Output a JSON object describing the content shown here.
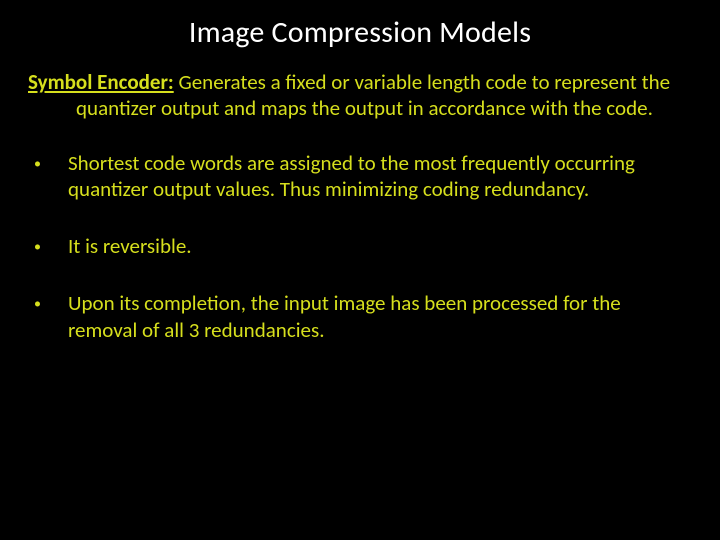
{
  "title": "Image Compression Models",
  "intro": {
    "label": "Symbol Encoder:",
    "text": " Generates a fixed or variable length code to represent the quantizer output and maps the output in accordance with the code."
  },
  "bullets": [
    "Shortest code words are assigned to the most frequently occurring quantizer output values. Thus minimizing coding redundancy.",
    "It is reversible.",
    "Upon its completion, the input image has been processed for the removal of all 3 redundancies."
  ]
}
